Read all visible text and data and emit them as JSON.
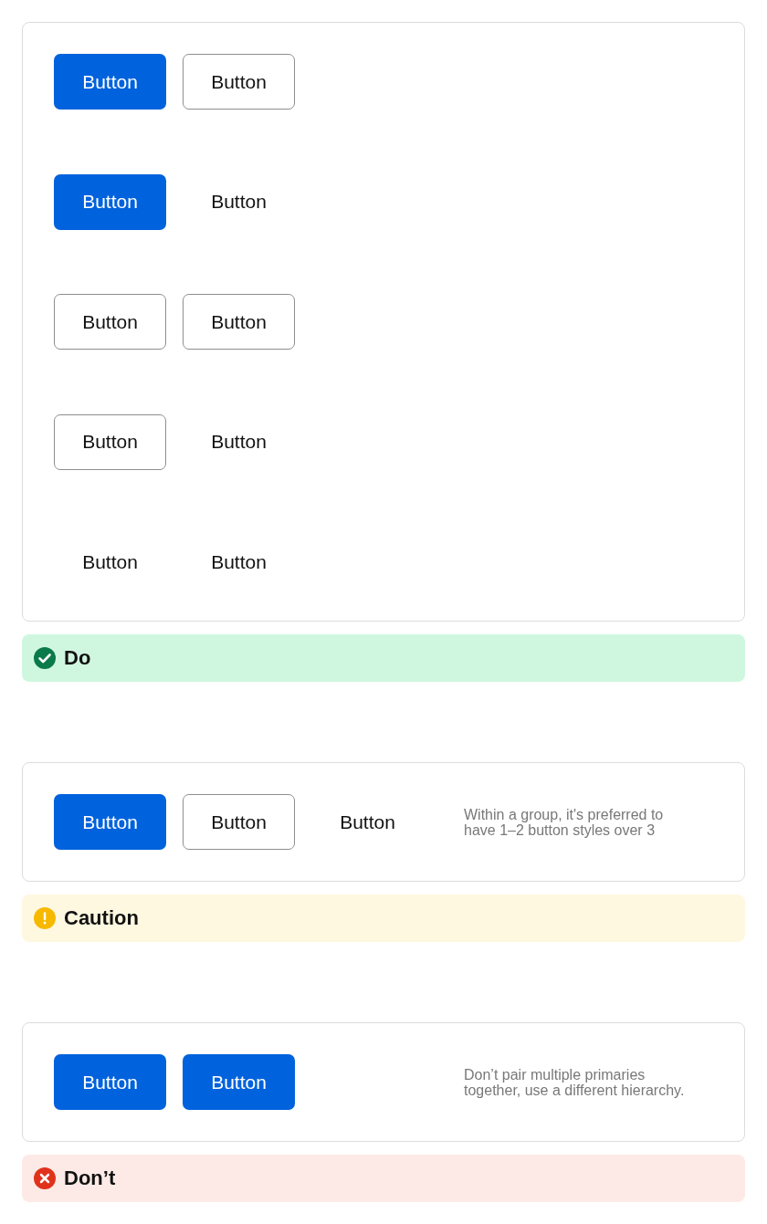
{
  "sections": [
    {
      "rows": [
        {
          "buttons": [
            {
              "label": "Button",
              "kind": "primary"
            },
            {
              "label": "Button",
              "kind": "secondary"
            }
          ]
        },
        {
          "buttons": [
            {
              "label": "Button",
              "kind": "primary"
            },
            {
              "label": "Button",
              "kind": "tertiary"
            }
          ]
        },
        {
          "buttons": [
            {
              "label": "Button",
              "kind": "secondary"
            },
            {
              "label": "Button",
              "kind": "secondary"
            }
          ]
        },
        {
          "buttons": [
            {
              "label": "Button",
              "kind": "secondary"
            },
            {
              "label": "Button",
              "kind": "tertiary"
            }
          ]
        },
        {
          "buttons": [
            {
              "label": "Button",
              "kind": "tertiary"
            },
            {
              "label": "Button",
              "kind": "tertiary"
            }
          ]
        }
      ],
      "verdict": {
        "kind": "do",
        "label": "Do"
      }
    },
    {
      "rows": [
        {
          "buttons": [
            {
              "label": "Button",
              "kind": "primary"
            },
            {
              "label": "Button",
              "kind": "secondary"
            },
            {
              "label": "Button",
              "kind": "tertiary"
            }
          ]
        }
      ],
      "note": "Within a group, it's preferred to have 1–2 button styles over 3",
      "verdict": {
        "kind": "caution",
        "label": "Caution"
      }
    },
    {
      "rows": [
        {
          "buttons": [
            {
              "label": "Button",
              "kind": "primary"
            },
            {
              "label": "Button",
              "kind": "primary"
            }
          ]
        }
      ],
      "note": "Don’t pair multiple primaries together, use a different hierarchy.",
      "verdict": {
        "kind": "dont",
        "label": "Don’t"
      }
    }
  ]
}
